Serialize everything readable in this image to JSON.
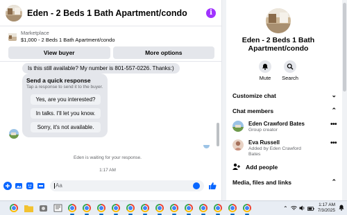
{
  "chat": {
    "title": "Eden - 2 Beds 1 Bath Apartment/condo",
    "marketplace_label": "Marketplace",
    "listing": "$1,000 - 2 Beds 1 Bath Apartment/condo",
    "view_buyer_label": "View buyer",
    "more_options_label": "More options",
    "sent_message": "Is this still available? My number is 801-557-0226. Thanks:)",
    "quick_response": {
      "title": "Send a quick response",
      "subtitle": "Tap a response to send it to the buyer.",
      "options": [
        "Yes, are you interested?",
        "In talks. I'll let you know.",
        "Sorry, it's not available."
      ]
    },
    "waiting_text": "Eden is waiting for your response.",
    "timestamp": "1:17 AM",
    "composer_placeholder": "Aa"
  },
  "info": {
    "title": "Eden - 2 Beds 1 Bath Apartment/condo",
    "mute_label": "Mute",
    "search_label": "Search",
    "customize_chat": "Customize chat",
    "chat_members": "Chat members",
    "members": [
      {
        "name": "Eden Crawford Bates",
        "role": "Group creator"
      },
      {
        "name": "Eva Russell",
        "role": "Added by Eden Crawford Bates"
      }
    ],
    "add_people": "Add people",
    "media_files_links": "Media, files and links"
  },
  "taskbar": {
    "time": "1:17 AM",
    "date": "7/3/2025"
  },
  "colors": {
    "accent": "#0866ff",
    "info_icon": "#a033ff",
    "bubble": "#e4e6eb",
    "secondary_text": "#65676b"
  }
}
